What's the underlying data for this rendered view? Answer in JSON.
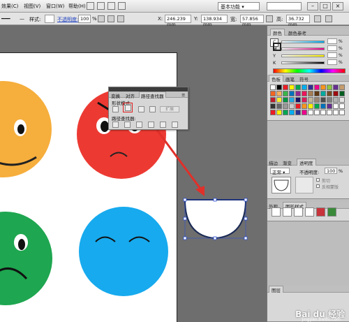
{
  "menubar": {
    "items": [
      "效果(",
      "视图(",
      "窗口(",
      "帮助("
    ],
    "keys": [
      "C)",
      "V)",
      "W)",
      "H)"
    ],
    "workspace": "基本功能"
  },
  "control_bar": {
    "stroke_label": "描边",
    "style_label": "样式:",
    "opacity_label": "不透明度:",
    "opacity_value": "100",
    "opacity_unit": "%",
    "x_label": "X:",
    "x_value": "246.239 mm",
    "y_label": "Y:",
    "y_value": "138.934 mm",
    "w_label": "宽:",
    "w_value": "57.856 mm",
    "h_label": "高:",
    "h_value": "36.732 mm"
  },
  "pathfinder": {
    "tabs": [
      "变换",
      "对齐",
      "路径查找器"
    ],
    "shape_mode_label": "形状模式:",
    "pathfinders_label": "路径查找器:",
    "expand_label": "扩展"
  },
  "color_panel": {
    "tabs": [
      "颜色",
      "颜色参考"
    ],
    "channels": [
      "C",
      "M",
      "Y",
      "K"
    ],
    "pct": "%"
  },
  "swatches_panel": {
    "tabs": [
      "色板",
      "画笔",
      "符号"
    ]
  },
  "transparency_panel": {
    "tabs": [
      "描边",
      "渐变",
      "透明度"
    ],
    "blend_mode": "正常",
    "opacity_label": "不透明度:",
    "opacity_value": "100",
    "opacity_unit": "%",
    "clip_label": "剪切",
    "invert_label": "反相蒙版"
  },
  "appearance_panel": {
    "tabs": [
      "外观",
      "图形样式"
    ]
  },
  "layers_panel": {
    "tabs": [
      "图层"
    ]
  },
  "watermark": {
    "brand": "Bai du 经验",
    "url": "jingyan.baidu.com"
  },
  "colors": {
    "yellow_face": "#f6ae3c",
    "red_face": "#ec3a33",
    "green_face": "#1ea650",
    "blue_face": "#17aaee",
    "arrow": "#e0302a",
    "selection": "#2b4fd4"
  }
}
